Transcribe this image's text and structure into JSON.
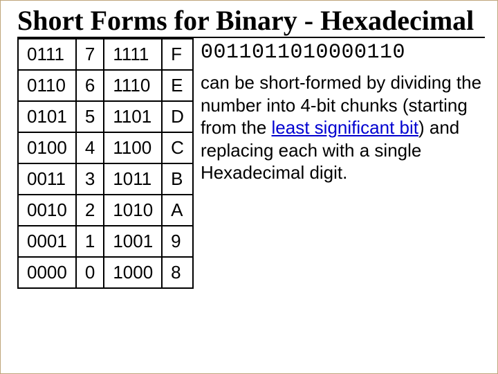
{
  "title": "Short Forms for Binary - Hexadecimal",
  "table": {
    "rows": [
      {
        "b0": "0111",
        "d0": "7",
        "b1": "1111",
        "d1": "F"
      },
      {
        "b0": "0110",
        "d0": "6",
        "b1": "1110",
        "d1": "E"
      },
      {
        "b0": "0101",
        "d0": "5",
        "b1": "1101",
        "d1": "D"
      },
      {
        "b0": "0100",
        "d0": "4",
        "b1": "1100",
        "d1": "C"
      },
      {
        "b0": "0011",
        "d0": "3",
        "b1": "1011",
        "d1": "B"
      },
      {
        "b0": "0010",
        "d0": "2",
        "b1": "1010",
        "d1": "A"
      },
      {
        "b0": "0001",
        "d0": "1",
        "b1": "1001",
        "d1": "9"
      },
      {
        "b0": "0000",
        "d0": "0",
        "b1": "1000",
        "d1": "8"
      }
    ]
  },
  "binary_string": "0011011010000110",
  "paragraph": {
    "p1": "can be short-formed by dividing the number into 4-bit chunks (starting from the ",
    "link": "least significant bit",
    "p2": ") and replacing each with a single Hexadecimal digit."
  }
}
